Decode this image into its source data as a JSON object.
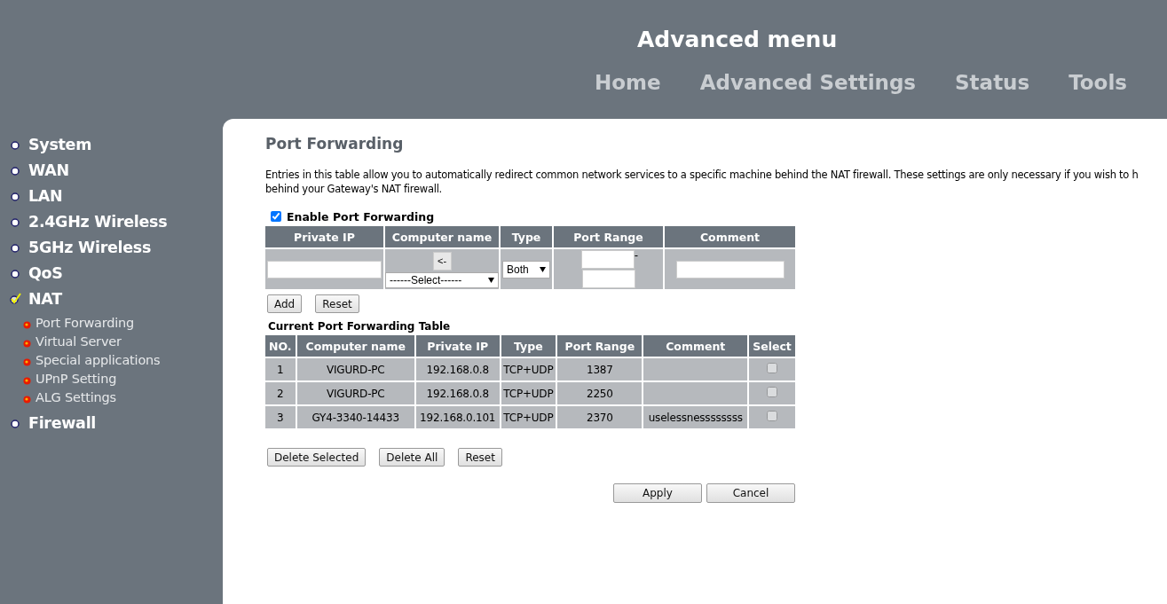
{
  "header": {
    "title": "Advanced menu",
    "nav": [
      {
        "label": "Home"
      },
      {
        "label": "Advanced Settings"
      },
      {
        "label": "Status"
      },
      {
        "label": "Tools"
      }
    ]
  },
  "sidebar": {
    "items": [
      {
        "label": "System",
        "selected": false
      },
      {
        "label": "WAN",
        "selected": false
      },
      {
        "label": "LAN",
        "selected": false
      },
      {
        "label": "2.4GHz Wireless",
        "selected": false
      },
      {
        "label": "5GHz Wireless",
        "selected": false
      },
      {
        "label": "QoS",
        "selected": false
      },
      {
        "label": "NAT",
        "selected": true,
        "children": [
          {
            "label": "Port Forwarding"
          },
          {
            "label": "Virtual Server"
          },
          {
            "label": "Special applications"
          },
          {
            "label": "UPnP Setting"
          },
          {
            "label": "ALG Settings"
          }
        ]
      },
      {
        "label": "Firewall",
        "selected": false
      }
    ]
  },
  "page": {
    "title": "Port Forwarding",
    "description_lines": [
      "Entries in this table allow you to automatically redirect common network services to a specific machine behind the NAT firewall. These settings are only necessary if you wish to h",
      "behind your Gateway's NAT firewall."
    ],
    "enable": {
      "label": "Enable Port Forwarding",
      "checked": true
    },
    "form": {
      "columns": [
        "Private IP",
        "Computer name",
        "Type",
        "Port Range",
        "Comment"
      ],
      "copy_button": "<-",
      "computer_select": "------Select------",
      "type_select": "Both",
      "port_separator": "-"
    },
    "form_buttons": [
      "Add",
      "Reset"
    ],
    "table": {
      "title": "Current Port Forwarding Table",
      "columns": [
        "NO.",
        "Computer name",
        "Private IP",
        "Type",
        "Port Range",
        "Comment",
        "Select"
      ],
      "rows": [
        {
          "no": "1",
          "computer": "VIGURD-PC",
          "ip": "192.168.0.8",
          "type": "TCP+UDP",
          "port": "1387",
          "comment": "",
          "selected": false
        },
        {
          "no": "2",
          "computer": "VIGURD-PC",
          "ip": "192.168.0.8",
          "type": "TCP+UDP",
          "port": "2250",
          "comment": "",
          "selected": false
        },
        {
          "no": "3",
          "computer": "GY4-3340-14433",
          "ip": "192.168.0.101",
          "type": "TCP+UDP",
          "port": "2370",
          "comment": "uselessnessssssss",
          "selected": false
        }
      ]
    },
    "table_buttons": [
      "Delete Selected",
      "Delete All",
      "Reset"
    ],
    "footer_buttons": [
      "Apply",
      "Cancel"
    ]
  }
}
